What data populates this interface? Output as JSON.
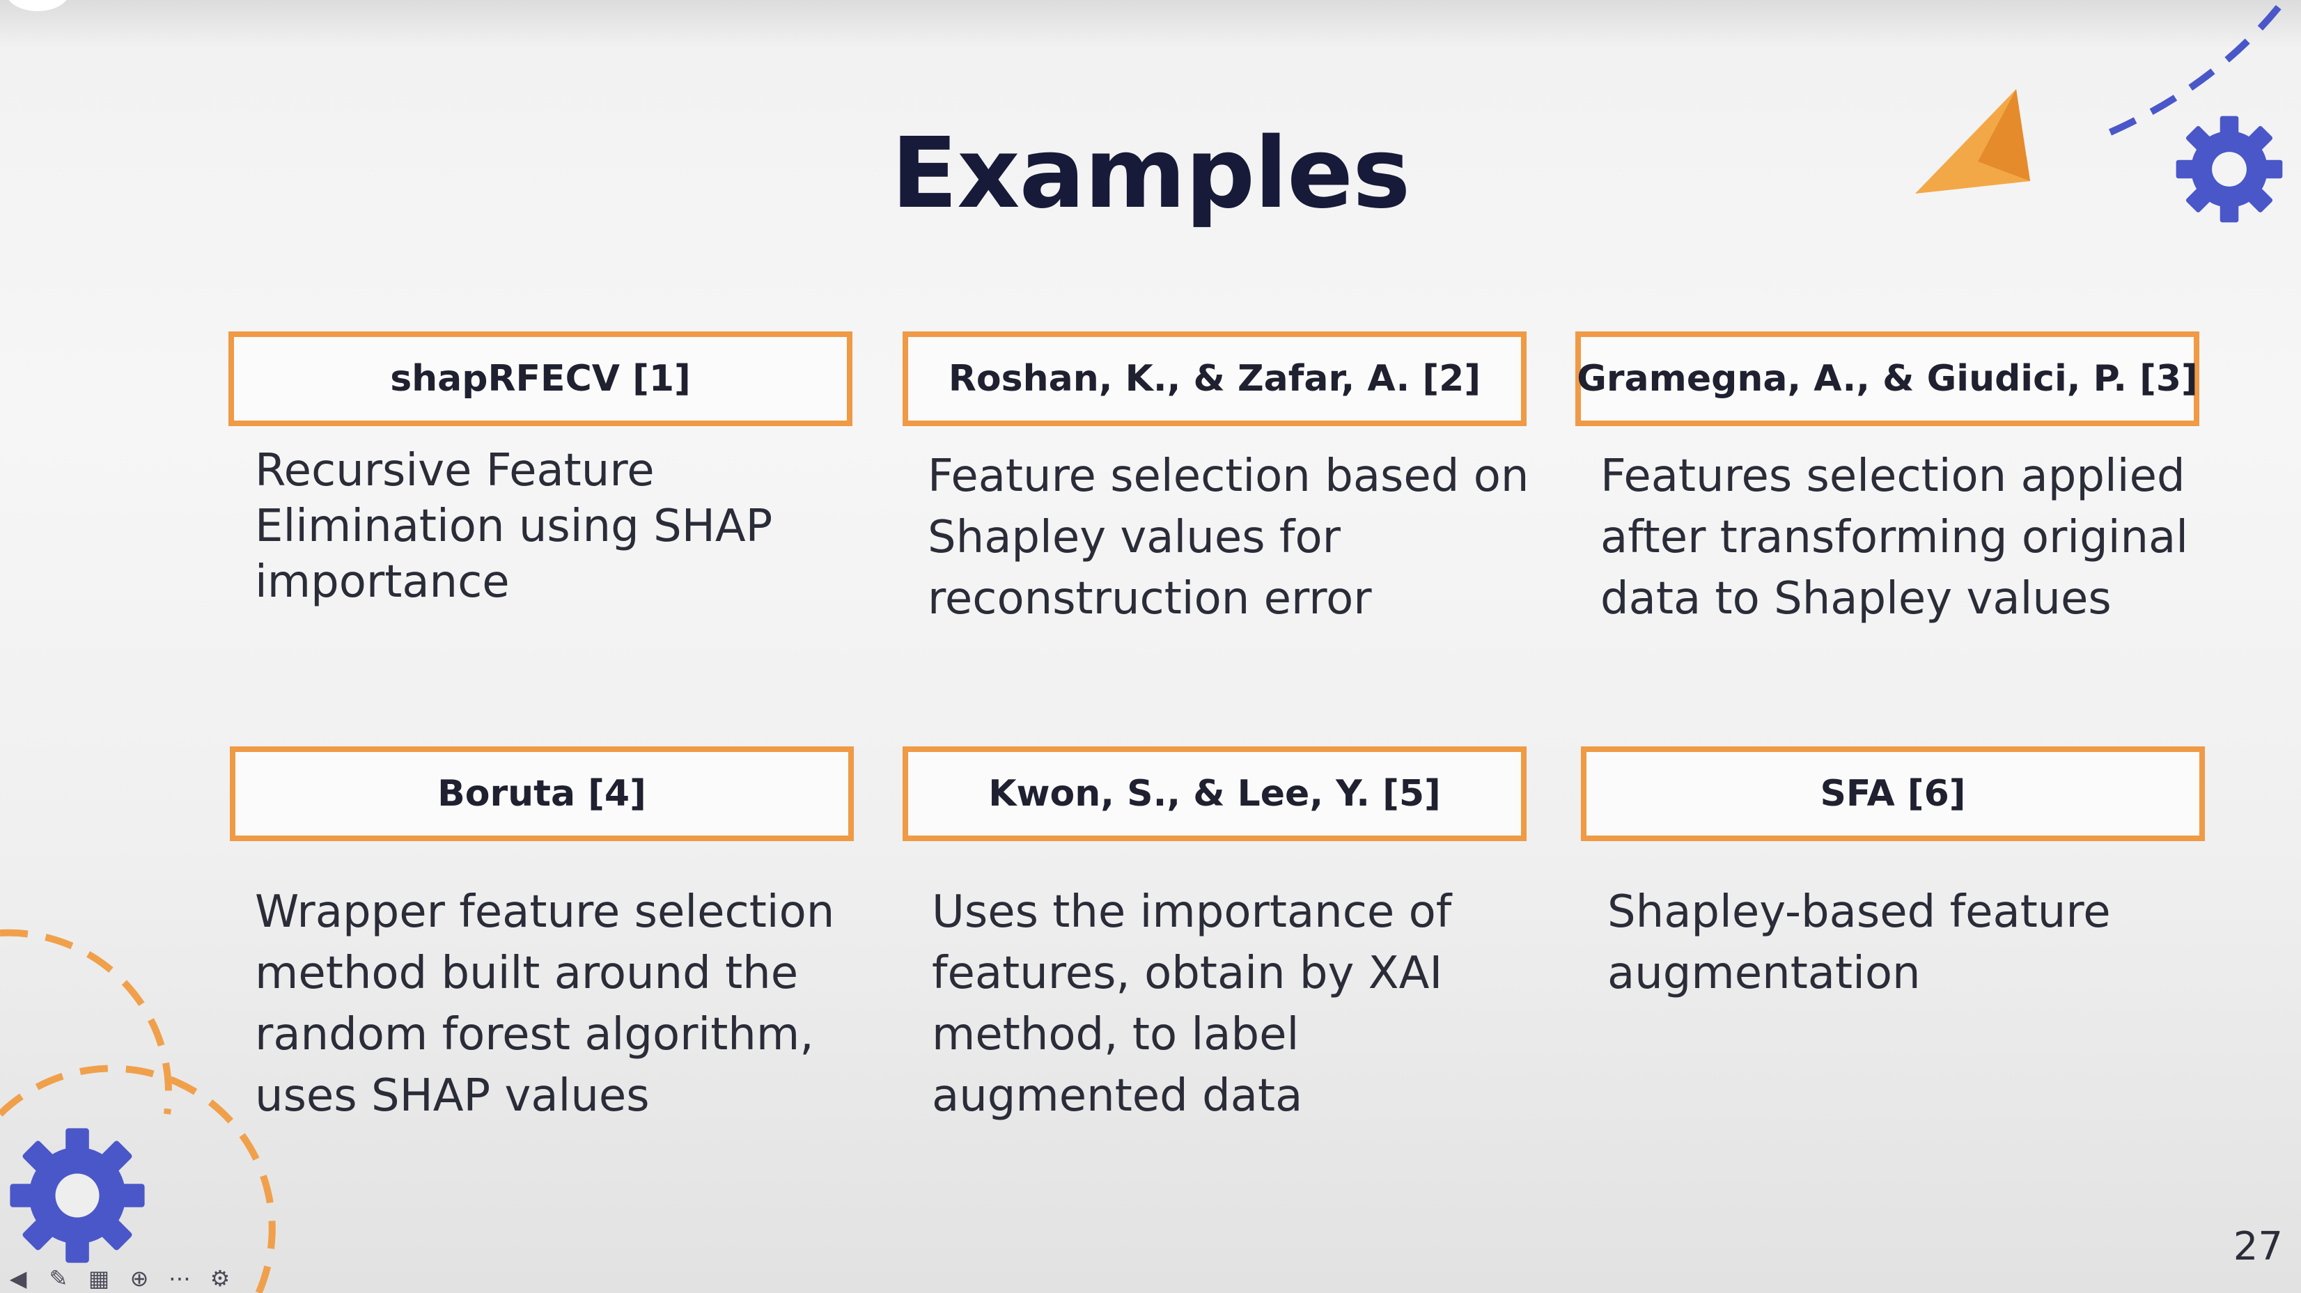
{
  "slide": {
    "title": "Examples",
    "page_number": "27",
    "accent_color": "#ef9a45",
    "gear_color": "#4a57c8",
    "cards": [
      {
        "header": "shapRFECV [1]",
        "lines": [
          "Recursive Feature",
          "Elimination using SHAP",
          "importance"
        ]
      },
      {
        "header": "Roshan, K., & Zafar, A. [2]",
        "lines": [
          "Feature selection based on",
          "Shapley values for",
          "reconstruction error"
        ]
      },
      {
        "header": "Gramegna, A., & Giudici, P. [3]",
        "lines": [
          "Features selection applied",
          "after transforming original",
          "data to Shapley values"
        ]
      },
      {
        "header": "Boruta [4]",
        "lines": [
          "Wrapper feature selection",
          "method built around the",
          "random forest algorithm,",
          "uses SHAP values"
        ]
      },
      {
        "header": "Kwon, S., & Lee, Y. [5]",
        "lines": [
          "Uses the importance of",
          "features, obtain by XAI",
          "method, to label",
          "augmented data"
        ]
      },
      {
        "header": "SFA [6]",
        "lines": [
          "Shapley-based feature",
          "augmentation"
        ]
      }
    ]
  },
  "decorations": {
    "paper_plane_icon": "paper-plane-icon",
    "gear_icons": [
      "gear-icon-top-right",
      "gear-icon-bottom-left"
    ]
  },
  "player_toolbar": {
    "icons": [
      "back-icon",
      "pen-icon",
      "grid-icon",
      "zoom-icon",
      "more-icon",
      "settings-icon"
    ]
  }
}
